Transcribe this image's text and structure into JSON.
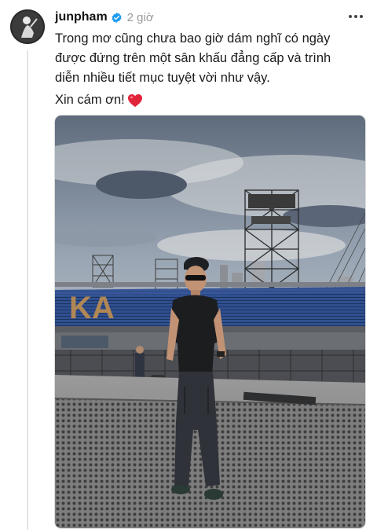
{
  "post": {
    "username": "junpham",
    "timestamp": "2 giờ",
    "caption_lines": [
      "Trong mơ cũng chưa bao giờ dám nghĩ có ngày",
      "được đứng trên một sân khấu đẳng cấp và trình",
      "diễn nhiều tiết mục tuyệt vời như vậy."
    ],
    "thanks_text": "Xin cám ơn!",
    "icons": {
      "verified": "verified-badge-icon",
      "more": "more-options-icon",
      "heart": "red-heart-emoji"
    },
    "photo": {
      "stand_letters": "KA"
    }
  },
  "colors": {
    "verified_blue": "#1d9bf0",
    "heart_red": "#e0243a",
    "timestamp_gray": "#999999"
  }
}
